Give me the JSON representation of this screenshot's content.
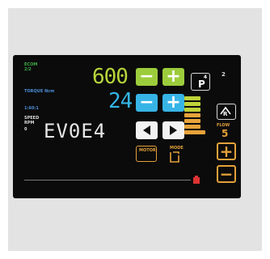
{
  "labels": {
    "mode_top": "ECOM",
    "mode_sub": "2/2",
    "torque_label": "TORQUE Ncm",
    "gear_label": "1:60:1",
    "side_label_1": "SPEED",
    "side_label_2": "RPM",
    "side_label_3": "0",
    "top_right_number": "2",
    "program_letter": "P",
    "program_sup": "4",
    "right_label": "FLOW",
    "right_value": "5",
    "bottom_box_label": "MOTOR",
    "bottom_box2_label": "MODE"
  },
  "speed": {
    "value": "600"
  },
  "torque": {
    "value": "24"
  },
  "model_code": "EV0E4",
  "controls": {
    "minus": "−",
    "plus": "+",
    "right_plus": "+",
    "right_minus": "−"
  },
  "colors": {
    "green": "#9ccc3c",
    "blue": "#37b4e6",
    "gold": "#e3a13a",
    "red": "#d33"
  }
}
